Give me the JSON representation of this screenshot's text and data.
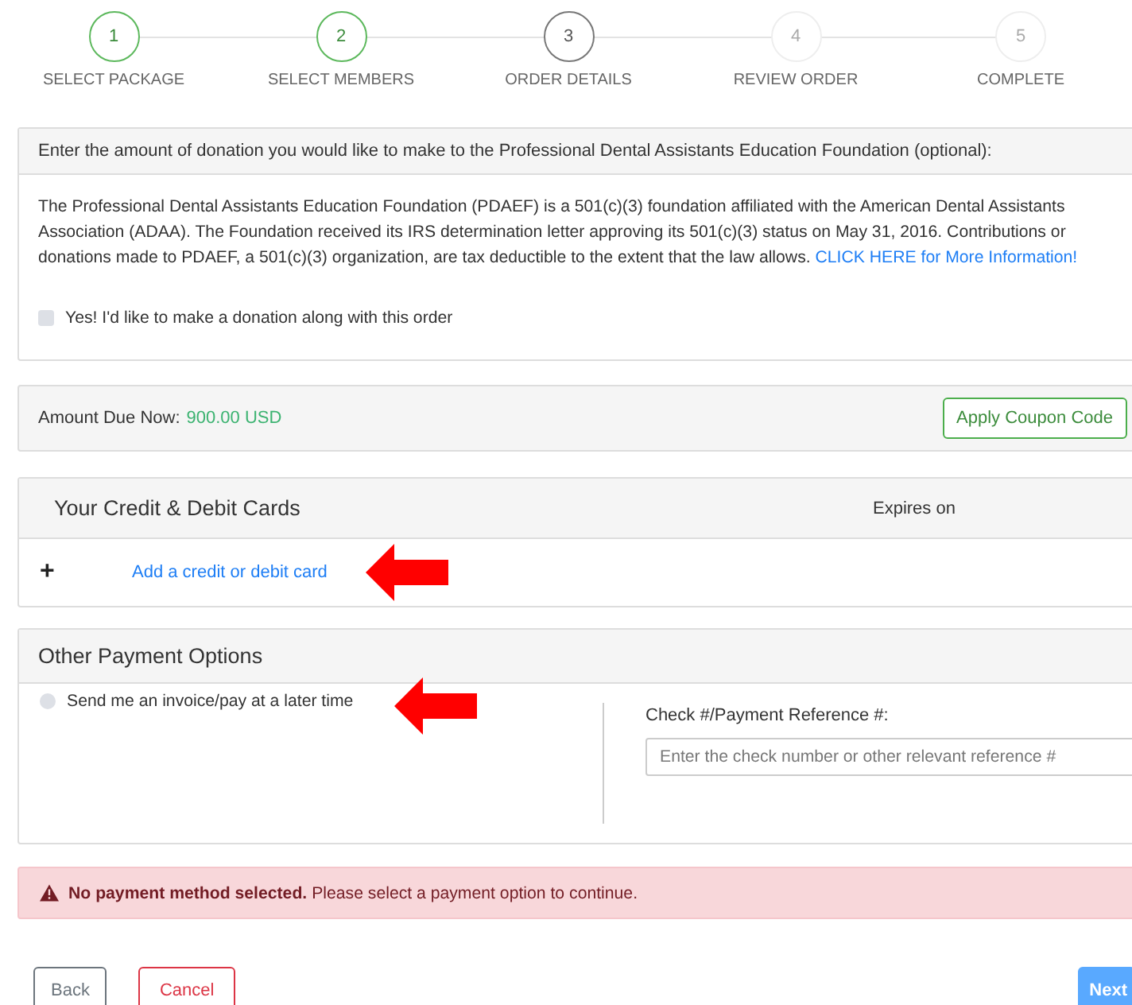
{
  "steps": [
    {
      "number": "1",
      "label": "SELECT PACKAGE",
      "done": true,
      "current": false
    },
    {
      "number": "2",
      "label": "SELECT MEMBERS",
      "done": true,
      "current": false
    },
    {
      "number": "3",
      "label": "ORDER DETAILS",
      "done": false,
      "current": true
    },
    {
      "number": "4",
      "label": "REVIEW ORDER",
      "done": false,
      "current": false
    },
    {
      "number": "5",
      "label": "COMPLETE",
      "done": false,
      "current": false
    }
  ],
  "donation": {
    "heading": "Enter the amount of donation you would like to make to the Professional Dental Assistants Education Foundation (optional):",
    "text": "The Professional Dental Assistants Education Foundation (PDAEF) is a 501(c)(3) foundation affiliated with the American Dental Assistants Association (ADAA). The Foundation received its IRS determination letter approving its 501(c)(3) status on May 31, 2016. Contributions or donations made to PDAEF, a 501(c)(3) organization, are tax deductible to the extent that the law allows.",
    "link": "CLICK HERE for More Information!",
    "checkbox": {
      "label": "Yes! I'd like to make a donation along with this order",
      "checked": false
    }
  },
  "amount": {
    "label": "Amount Due Now:",
    "value": "900.00 USD",
    "button": "Apply Coupon Code"
  },
  "cards": {
    "heading": "Your Credit & Debit Cards",
    "expires_heading": "Expires on",
    "add_icon": "+",
    "add_link": "Add a credit or debit card"
  },
  "other": {
    "heading": "Other Payment Options",
    "radio": {
      "label": "Send me an invoice/pay at a later time",
      "selected": false
    },
    "reference_label": "Check #/Payment Reference #:",
    "reference_placeholder": "Enter the check number or other relevant reference #"
  },
  "alert": "**No payment method selected.**  Please select a payment option to continue.",
  "buttons": {
    "back": "Back",
    "cancel": "Cancel",
    "next": "Next"
  }
}
